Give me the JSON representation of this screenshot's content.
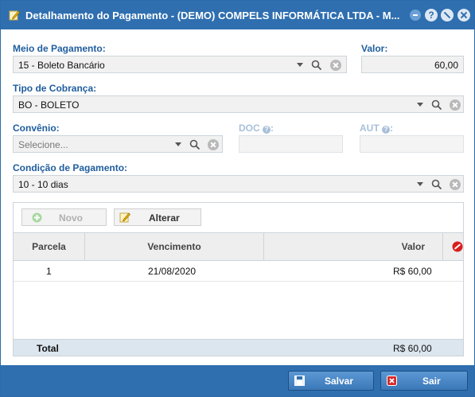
{
  "window": {
    "title": "Detalhamento do Pagamento - (DEMO) COMPELS INFORMÁTICA LTDA - M...",
    "help_label": "?"
  },
  "form": {
    "meio_pagamento": {
      "label": "Meio de Pagamento:",
      "value": "15 - Boleto Bancário"
    },
    "valor": {
      "label": "Valor:",
      "value": "60,00"
    },
    "tipo_cobranca": {
      "label": "Tipo de Cobrança:",
      "value": "BO - BOLETO"
    },
    "convenio": {
      "label": "Convênio:",
      "placeholder": "Selecione..."
    },
    "doc": {
      "label": "DOC",
      "value": ""
    },
    "aut": {
      "label": "AUT",
      "value": ""
    },
    "condicao_pagamento": {
      "label": "Condição de Pagamento:",
      "value": "10 - 10 dias"
    }
  },
  "grid": {
    "toolbar": {
      "novo_label": "Novo",
      "alterar_label": "Alterar"
    },
    "columns": [
      "Parcela",
      "Vencimento",
      "Valor"
    ],
    "rows": [
      {
        "parcela": "1",
        "vencimento": "21/08/2020",
        "valor": "R$ 60,00"
      }
    ],
    "total": {
      "label": "Total",
      "value": "R$ 60,00"
    }
  },
  "footer": {
    "save_label": "Salvar",
    "exit_label": "Sair"
  },
  "colors": {
    "accent": "#2f6fb0",
    "label": "#1f5d9e"
  }
}
